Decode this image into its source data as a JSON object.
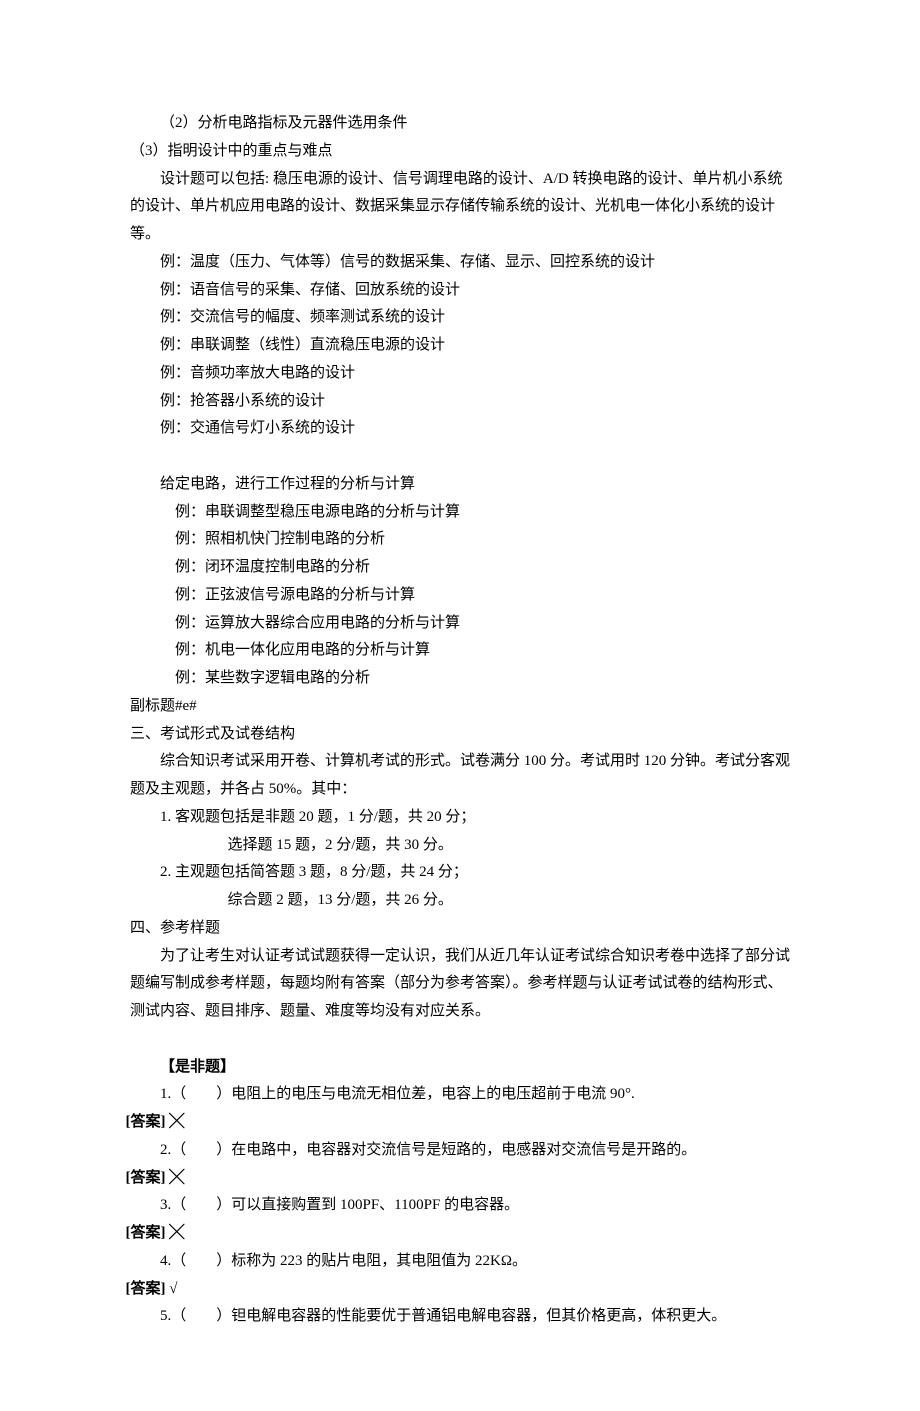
{
  "p2": "（2）分析电路指标及元器件选用条件",
  "p3": "（3）指明设计中的重点与难点",
  "design_intro": "设计题可以包括: 稳压电源的设计、信号调理电路的设计、A/D 转换电路的设计、单片机小系统的设计、单片机应用电路的设计、数据采集显示存储传输系统的设计、光机电一体化小系统的设计等。",
  "ex_design": [
    "例：温度（压力、气体等）信号的数据采集、存储、显示、回控系统的设计",
    "例：语音信号的采集、存储、回放系统的设计",
    "例：交流信号的幅度、频率测试系统的设计",
    "例：串联调整（线性）直流稳压电源的设计",
    "例：音频功率放大电路的设计",
    "例：抢答器小系统的设计",
    "例：交通信号灯小系统的设计"
  ],
  "analysis_intro": "给定电路，进行工作过程的分析与计算",
  "ex_analysis": [
    "例：串联调整型稳压电源电路的分析与计算",
    "例：照相机快门控制电路的分析",
    "例：闭环温度控制电路的分析",
    "例：正弦波信号源电路的分析与计算",
    "例：运算放大器综合应用电路的分析与计算",
    "例：机电一体化应用电路的分析与计算",
    "例：某些数字逻辑电路的分析"
  ],
  "subtitle_tag": " 副标题#e#",
  "h3": "三、考试形式及试卷结构",
  "s3_p1": "综合知识考试采用开卷、计算机考试的形式。试卷满分 100 分。考试用时 120 分钟。考试分客观题及主观题，并各占 50%。其中：",
  "s3_li1": "1. 客观题包括是非题 20 题，1 分/题，共 20 分；",
  "s3_li1b": "选择题 15 题，2 分/题，共 30 分。",
  "s3_li2": "2. 主观题包括简答题 3 题，8 分/题，共 24 分；",
  "s3_li2b": "综合题 2 题，13 分/题，共 26 分。",
  "h4": "四、参考样题",
  "s4_p1": "为了让考生对认证考试试题获得一定认识，我们从近几年认证考试综合知识考卷中选择了部分试题编写制成参考样题，每题均附有答案（部分为参考答案）。参考样题与认证考试试卷的结构形式、测试内容、题目排序、题量、难度等均没有对应关系。",
  "tf_header": "【是非题】",
  "tf": [
    {
      "n": "1.（　　）电阻上的电压与电流无相位差，电容上的电压超前于电流 90°.",
      "ans": "[答案] ╳"
    },
    {
      "n": "2.（　　）在电路中，电容器对交流信号是短路的，电感器对交流信号是开路的。",
      "ans": "[答案] ╳"
    },
    {
      "n": "3.（　　）可以直接购置到 100PF、1100PF 的电容器。",
      "ans": "[答案] ╳"
    },
    {
      "n": "4.（　　）标称为 223 的贴片电阻，其电阻值为 22KΩ。",
      "ans": "[答案] √"
    },
    {
      "n": "5.（　　）钽电解电容器的性能要优于普通铝电解电容器，但其价格更高，体积更大。",
      "ans": ""
    }
  ]
}
